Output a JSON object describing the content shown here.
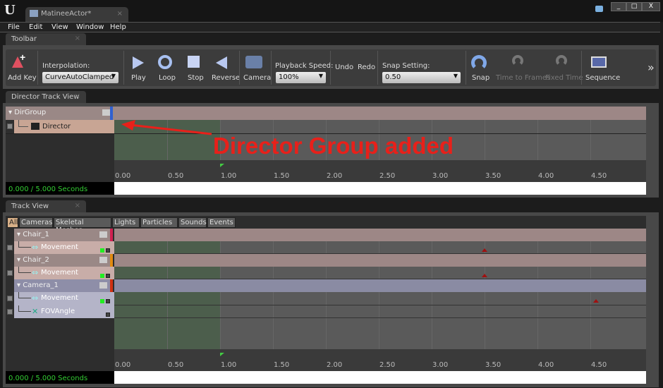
{
  "window": {
    "tab_title": "MatineeActor*",
    "controls": [
      "_",
      "□",
      "X"
    ]
  },
  "menu": [
    "File",
    "Edit",
    "View",
    "Window",
    "Help"
  ],
  "toolbar": {
    "tab": "Toolbar",
    "add_key": "Add Key",
    "interpolation_label": "Interpolation:",
    "interpolation_value": "CurveAutoClamped",
    "play": "Play",
    "loop": "Loop",
    "stop": "Stop",
    "reverse": "Reverse",
    "camera": "Camera",
    "playback_label": "Playback Speed:",
    "playback_value": "100%",
    "undo": "Undo",
    "redo": "Redo",
    "snap_label": "Snap Setting:",
    "snap_value": "0.50",
    "snap": "Snap",
    "time_to_frames": "Time to Frames",
    "fixed_time": "Fixed Time",
    "sequence": "Sequence",
    "more": "»"
  },
  "director": {
    "tab": "Director Track View",
    "group": "DirGroup",
    "track": "Director",
    "time": "0.000 / 5.000 Seconds",
    "group_color": "#3060d0"
  },
  "annotation": {
    "text": "Director Group added",
    "color": "#e8201a"
  },
  "ticks": [
    "0.00",
    "0.50",
    "1.00",
    "1.50",
    "2.00",
    "2.50",
    "3.00",
    "3.50",
    "4.00",
    "4.50"
  ],
  "trackview": {
    "tab": "Track View",
    "filters": [
      "All",
      "Cameras",
      "Skeletal Meshes",
      "Lights",
      "Particles",
      "Sounds",
      "Events"
    ],
    "time": "0.000 / 5.000 Seconds",
    "rows": [
      {
        "type": "group",
        "label": "Chair_1",
        "color": "#d02050",
        "kind": "actor"
      },
      {
        "type": "track",
        "label": "Movement",
        "icon": "movement",
        "key": 3.5
      },
      {
        "type": "group",
        "label": "Chair_2",
        "color": "#e08a10",
        "kind": "actor"
      },
      {
        "type": "track",
        "label": "Movement",
        "icon": "movement",
        "key": 3.5
      },
      {
        "type": "group",
        "label": "Camera_1",
        "color": "#d03010",
        "kind": "camera"
      },
      {
        "type": "track",
        "label": "Movement",
        "icon": "movement",
        "key": 4.55,
        "kind": "camera"
      },
      {
        "type": "track",
        "label": "FOVAngle",
        "icon": "fov",
        "kind": "camera"
      }
    ]
  }
}
